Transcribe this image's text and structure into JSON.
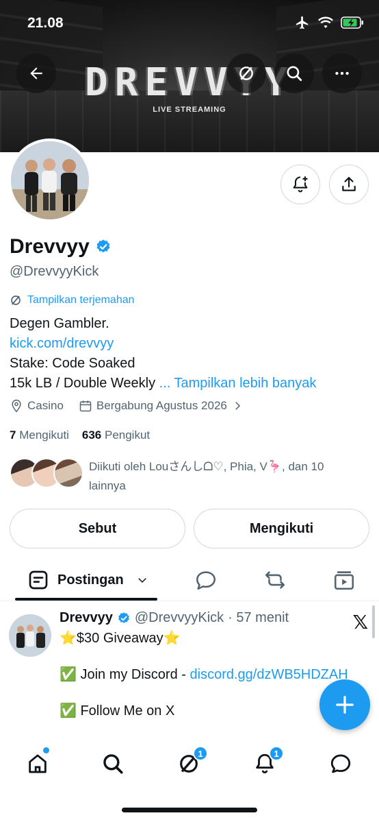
{
  "status_bar": {
    "time": "21.08"
  },
  "banner": {
    "logo_text": "DREVVYY",
    "subtitle": "LIVE STREAMING"
  },
  "profile": {
    "name": "Drevvyy",
    "handle": "@DrevvyyKick",
    "translate": "Tampilkan terjemahan",
    "bio_line1": "Degen Gambler.",
    "bio_link": "kick.com/drevvyy",
    "bio_line3": "Stake: Code Soaked",
    "bio_line4": "15k LB / Double Weekly",
    "show_more": "... Tampilkan lebih banyak",
    "location": "Casino",
    "joined": "Bergabung Agustus 2026",
    "following_count": "7",
    "following_label": "Mengikuti",
    "followers_count": "636",
    "followers_label": "Pengikut",
    "followed_by": "Diikuti oleh Louさんしᗝ♡, Phia, V🦩, dan 10 lainnya"
  },
  "actions": {
    "mention": "Sebut",
    "following": "Mengikuti"
  },
  "tabs": {
    "posts": "Postingan"
  },
  "post": {
    "name": "Drevvyy",
    "handle": "@DrevvyyKick",
    "time": "· 57 menit",
    "line1": "⭐$30 Giveaway⭐",
    "line2_text": "✅ Join my Discord - ",
    "line2_link": "discord.gg/dzWB5HDZAH",
    "line3": "✅ Follow Me on X"
  },
  "nav": {
    "grok_badge": "1",
    "notif_badge": "1"
  },
  "colors": {
    "accent": "#1d9bf0",
    "text": "#0f1419",
    "muted": "#536471"
  }
}
